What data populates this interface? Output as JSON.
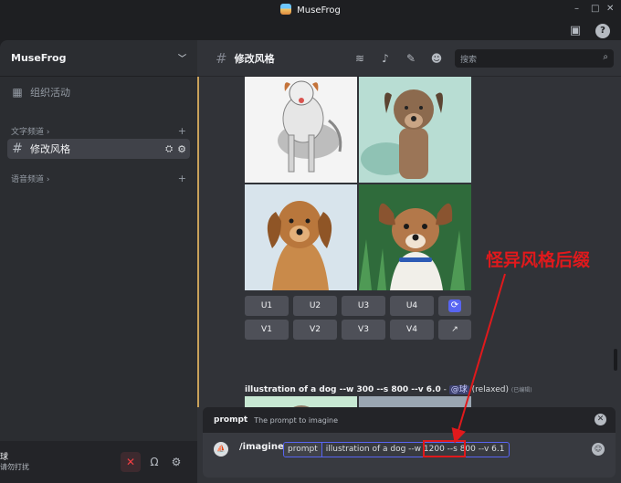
{
  "app": {
    "title": "MuseFrog"
  },
  "server": {
    "name": "MuseFrog"
  },
  "sidebar": {
    "events_label": "组织活动",
    "text_category": "文字频道",
    "active_channel": "修改风格",
    "voice_category": "语音频道"
  },
  "user": {
    "name": "球",
    "status": "请勿打扰"
  },
  "channel": {
    "name": "修改风格"
  },
  "search": {
    "placeholder": "搜索"
  },
  "buttons_row1": [
    "U1",
    "U2",
    "U3",
    "U4"
  ],
  "buttons_row2": [
    "V1",
    "V2",
    "V3",
    "V4"
  ],
  "message": {
    "prompt_text": "illustration of a dog --w 300 --s 800 --v 6.0",
    "separator": " - ",
    "mention": "@球",
    "mode": "(relaxed)",
    "edited": "(已编辑)"
  },
  "command": {
    "option_name": "prompt",
    "option_desc": "The prompt to imagine",
    "slash": "/imagine",
    "param": "prompt",
    "value": "illustration of a dog --w 1200 --s 800 --v 6.1"
  },
  "annotation": {
    "label": "怪异风格后缀"
  },
  "colors": {
    "accent": "#5865f2",
    "annotation": "#e0191c",
    "highlight_bar": "#c9a15a"
  },
  "icons": [
    "threads-icon",
    "bell-icon",
    "pin-icon",
    "members-icon",
    "search-icon",
    "inbox-icon",
    "help-icon",
    "calendar-icon",
    "gear-icon",
    "headphones-icon",
    "muted-mic-icon",
    "refresh-icon",
    "open-link-icon",
    "emoji-icon"
  ]
}
